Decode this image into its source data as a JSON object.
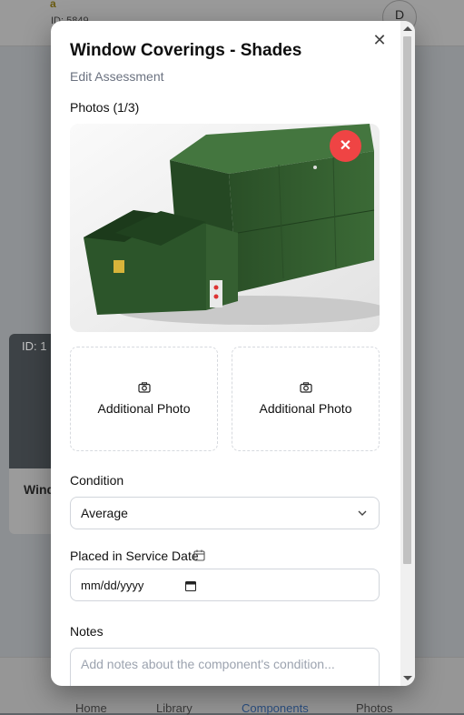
{
  "background": {
    "top_letter": "a",
    "top_id": "ID: 5849",
    "avatar_initial": "D",
    "card_id": "ID: 1",
    "card_name": "Wind",
    "nav": [
      "Home",
      "Library",
      "Components",
      "Photos"
    ]
  },
  "modal": {
    "title": "Window Coverings - Shades",
    "subtitle": "Edit Assessment",
    "close_icon": "x-icon",
    "photos_label": "Photos (1/3)",
    "remove_icon": "x-icon",
    "additional_photo_label": "Additional Photo",
    "condition_label": "Condition",
    "condition_value": "Average",
    "placed_in_service_label": "Placed in Service Date",
    "date_placeholder": "mm/dd/yyyy",
    "notes_label": "Notes",
    "notes_placeholder": "Add notes about the component's condition..."
  },
  "colors": {
    "remove_button": "#ef4444",
    "equipment_green": "#2f5a2c"
  }
}
